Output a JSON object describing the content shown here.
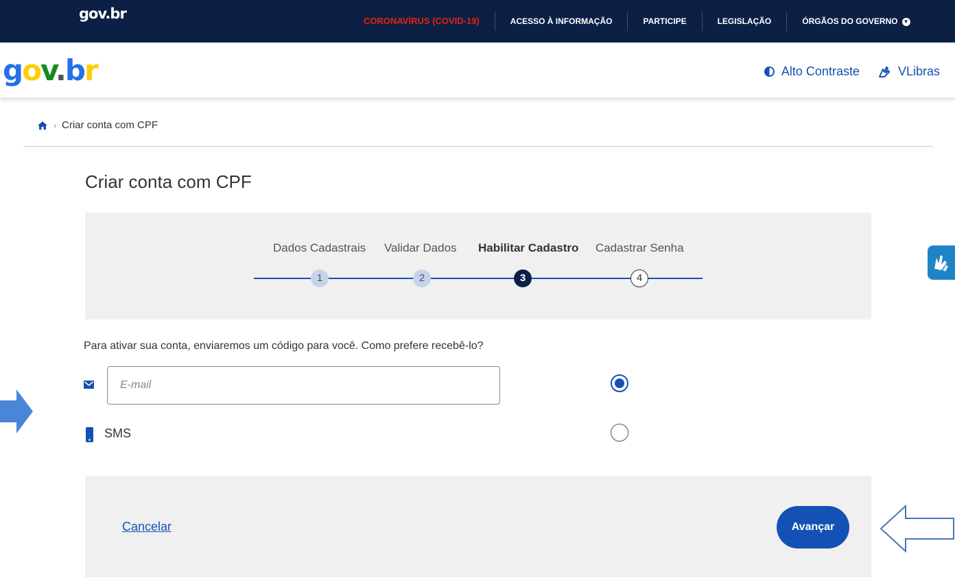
{
  "topbar": {
    "logo": "gov.br",
    "links": [
      "CORONAVÍRUS (COVID-19)",
      "ACESSO À INFORMAÇÃO",
      "PARTICIPE",
      "LEGISLAÇÃO",
      "ÓRGÃOS DO GOVERNO"
    ]
  },
  "header": {
    "logo": "gov.br",
    "alto_contraste": "Alto Contraste",
    "vlibras": "VLibras"
  },
  "breadcrumb": {
    "current": "Criar conta com CPF"
  },
  "page_title": "Criar conta com CPF",
  "stepper": {
    "steps": [
      {
        "label": "Dados Cadastrais",
        "number": "1",
        "state": "done"
      },
      {
        "label": "Validar Dados",
        "number": "2",
        "state": "done"
      },
      {
        "label": "Habilitar Cadastro",
        "number": "3",
        "state": "active"
      },
      {
        "label": "Cadastrar Senha",
        "number": "4",
        "state": "todo"
      }
    ]
  },
  "question": "Para ativar sua conta, enviaremos um código para você. Como prefere recebê-lo?",
  "options": {
    "email_placeholder": "E-mail",
    "sms_label": "SMS",
    "selected": "email"
  },
  "actions": {
    "cancel": "Cancelar",
    "next": "Avançar"
  },
  "colors": {
    "primary": "#1351b4",
    "navy": "#0c2046",
    "covid_red": "#e52207",
    "panel_gray": "#f0f0f0"
  }
}
